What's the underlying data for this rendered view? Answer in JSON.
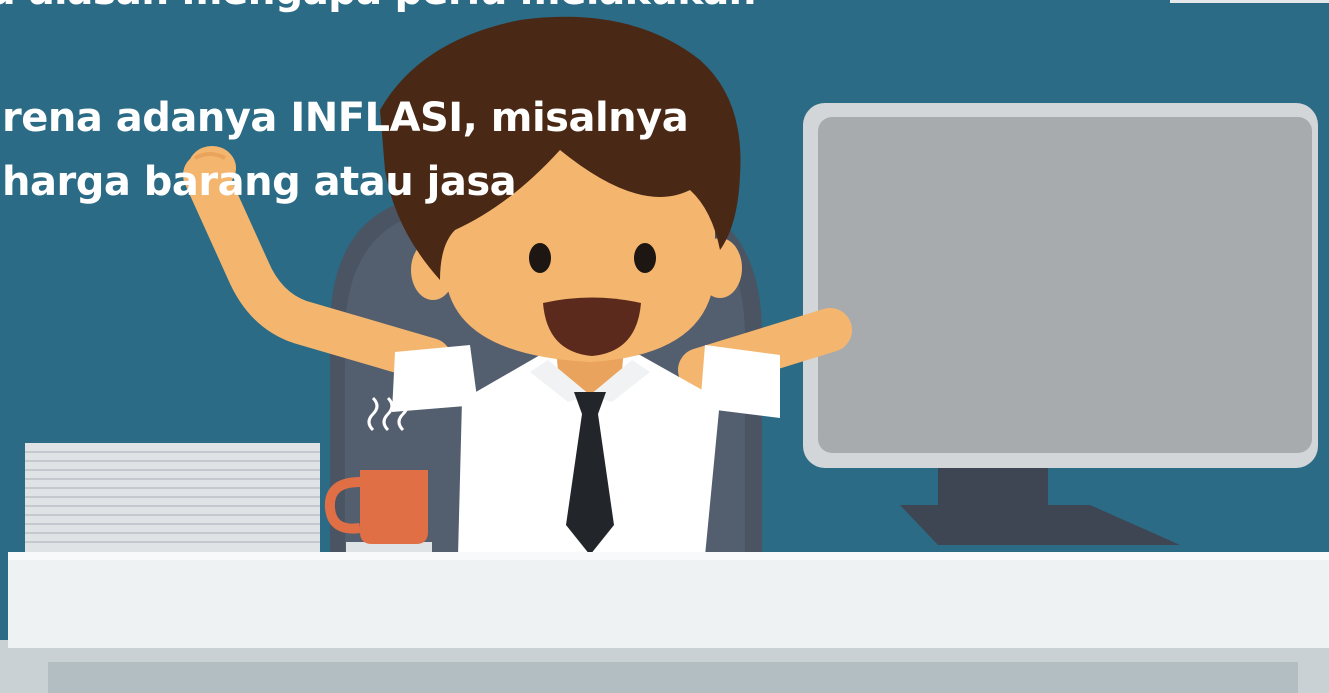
{
  "slide": {
    "heading_fragment": "u alasan mengapa perlu melakukan",
    "body_line_1": "rena adanya INFLASI, misalnya",
    "body_line_2": "harga barang atau jasa"
  },
  "illustration": {
    "subject": "happy office worker at desk with raised arms",
    "icons": [
      "office-worker",
      "computer-monitor",
      "coffee-mug-icon",
      "paper-stack",
      "office-chair",
      "desk"
    ]
  },
  "colors": {
    "background": "#2b6b85",
    "desk": "#eef2f3",
    "monitor": "#a8abae",
    "monitor_bezel": "#d3d6d8",
    "monitor_stand": "#3e4653",
    "chair": "#4a5463",
    "skin": "#f4b66f",
    "hair": "#4a2816",
    "shirt": "#ffffff",
    "tie": "#22262b",
    "mug": "#e06f45",
    "text": "#ffffff"
  }
}
